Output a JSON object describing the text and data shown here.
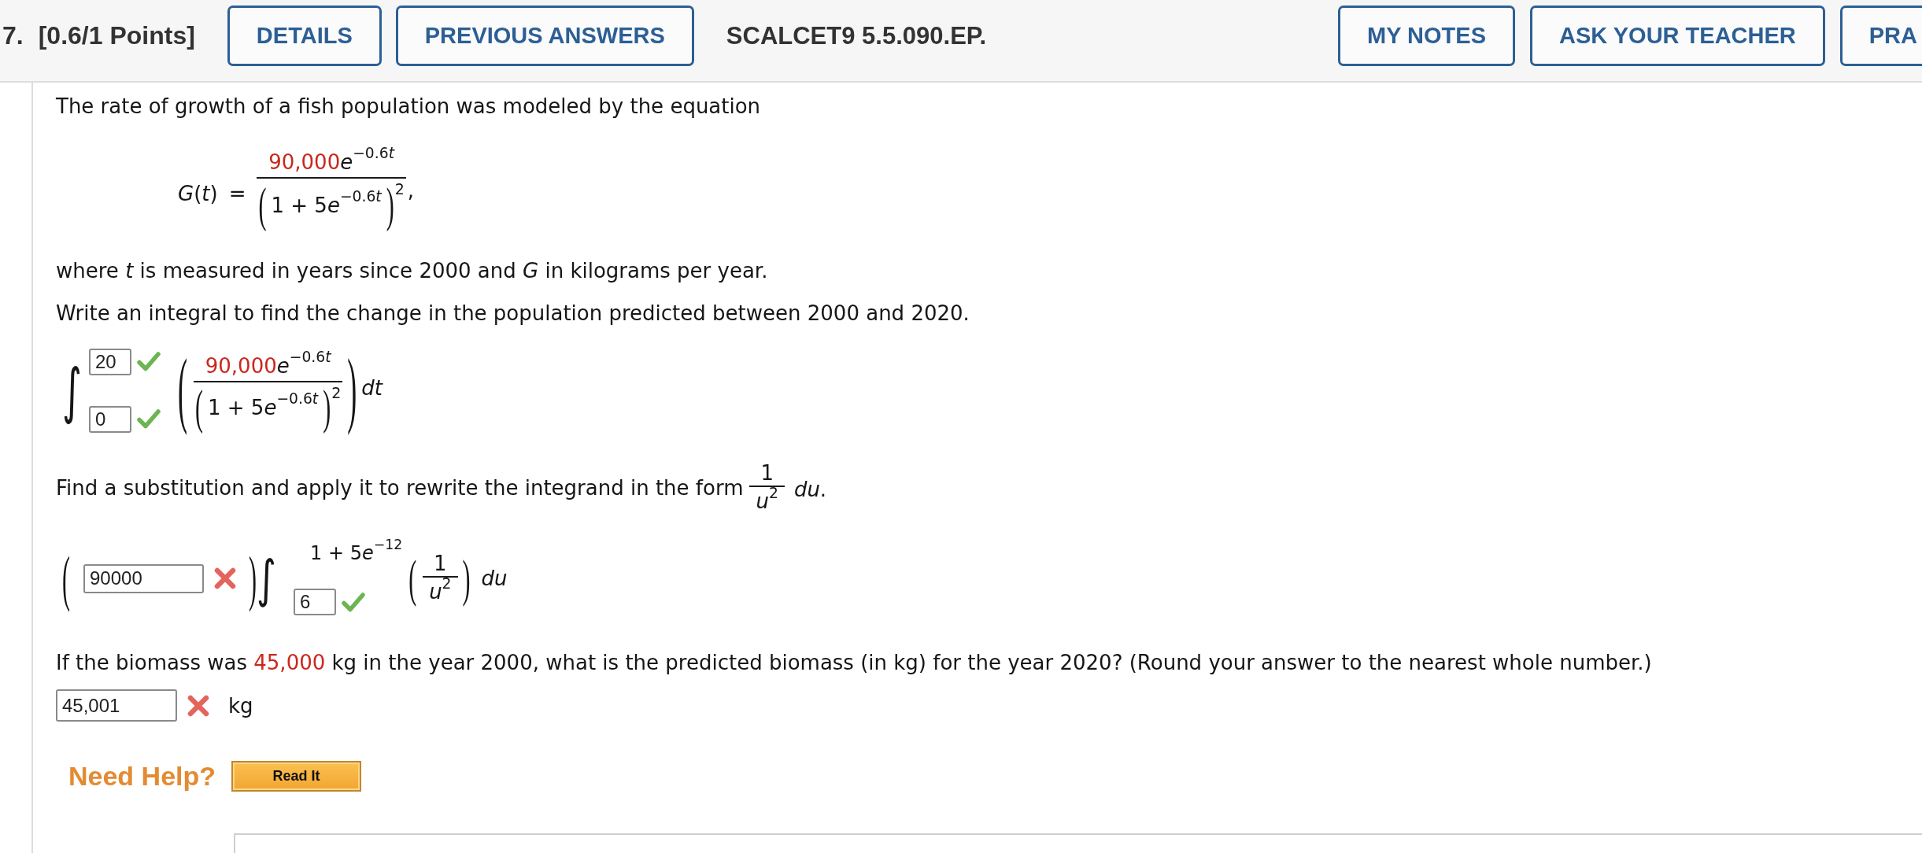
{
  "header": {
    "number": "7.",
    "points": "[0.6/1 Points]",
    "left_buttons": [
      "DETAILS",
      "PREVIOUS ANSWERS"
    ],
    "code": "SCALCET9 5.5.090.EP.",
    "right_buttons": [
      "MY NOTES",
      "ASK YOUR TEACHER",
      "PRA"
    ]
  },
  "intro": "The rate of growth of a fish population was modeled by the equation",
  "equation": {
    "lhs": "*G*(*t*)",
    "relation": "=",
    "fraction": {
      "numerator": {
        "coefficient": "90,000",
        "base": "e",
        "exponent": "−0.6",
        "variable": "t"
      },
      "denominator": {
        "open": "(",
        "lead": "1 + 5",
        "base": "e",
        "exponent": "−0.6",
        "variable": "t",
        "close": ")",
        "power": "2"
      }
    },
    "trailing": ","
  },
  "definition": "where *t* is measured in years since 2000 and *G* in kilograms per year.",
  "integral_prompt": "Write an integral to find the change in the population predicted between 2000 and 2020.",
  "integral": {
    "symbol": "∫",
    "upper": {
      "value": "20",
      "correct": true
    },
    "lower": {
      "value": "0",
      "correct": true
    },
    "open": "(",
    "fraction": {
      "numerator": {
        "coefficient": "90,000",
        "base": "e",
        "exponent": "−0.6",
        "variable": "t"
      },
      "denominator": {
        "open": "(",
        "lead": "1 + 5",
        "base": "e",
        "exponent": "−0.6",
        "variable": "t",
        "close": ")",
        "power": "2"
      }
    },
    "close": ")",
    "differential": "*dt*"
  },
  "substitution_prompt": {
    "text": "Find a substitution and apply it to rewrite the integrand in the form",
    "fraction": {
      "numerator": "1",
      "denominator": "*u*$^{2}$"
    },
    "differential": "*du*."
  },
  "substitution": {
    "open": "(",
    "coefficient": {
      "value": "90000",
      "correct": false
    },
    "close": ")",
    "symbol": "∫",
    "upper": {
      "lead": "1 + 5",
      "base": "e",
      "exponent": "−12"
    },
    "lower": {
      "value": "6",
      "correct": true
    },
    "integrand_open": "(",
    "fraction": {
      "numerator": "1",
      "denominator": "*u*$^{2}$"
    },
    "integrand_close": ")",
    "differential": "*du*"
  },
  "biomass_question": {
    "before": "If the biomass was",
    "value": "45,000",
    "after": "kg in the year 2000, what is the predicted biomass (in kg) for the year 2020? (Round your answer to the nearest whole number.)"
  },
  "answer": {
    "value": "45,001",
    "correct": false,
    "unit": "kg"
  },
  "help": {
    "label": "Need Help?",
    "buttons": [
      "Read It"
    ]
  }
}
